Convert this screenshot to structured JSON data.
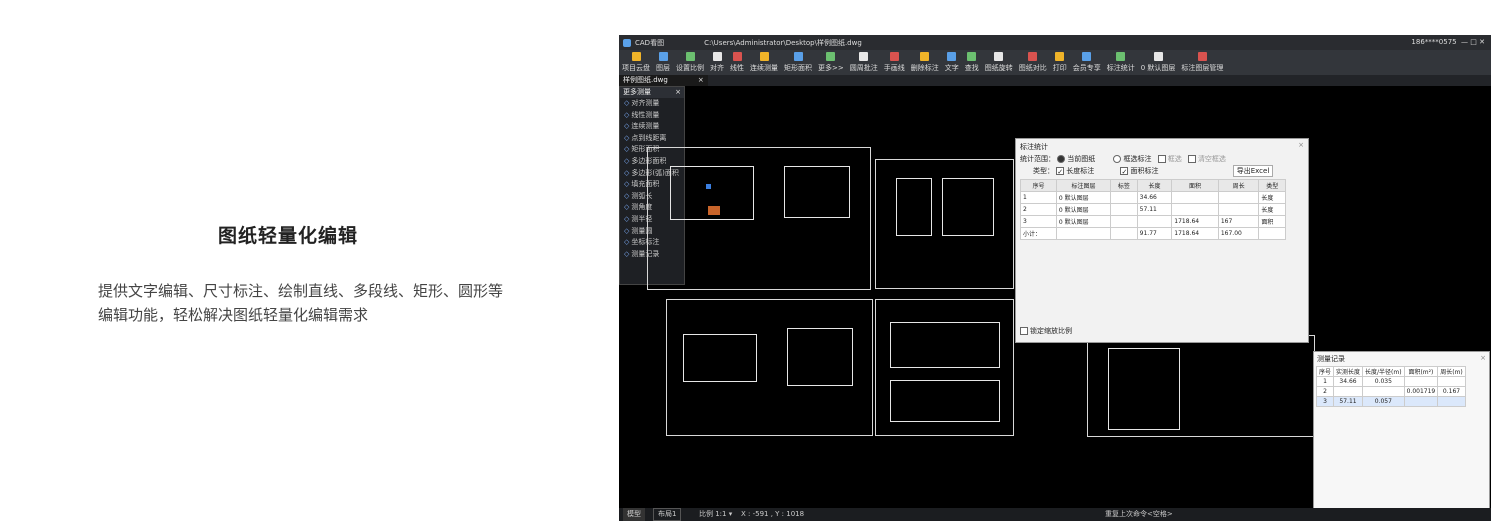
{
  "headline": "图纸轻量化编辑",
  "description": "提供文字编辑、尺寸标注、绘制直线、多段线、矩形、圆形等编辑功能，轻松解决图纸轻量化编辑需求",
  "app": {
    "title": "CAD看图",
    "path": "C:\\Users\\Administrator\\Desktop\\样例图纸.dwg",
    "account": "186****0575",
    "ribbon": [
      "项目云盘",
      "图层",
      "设置比例",
      "对齐",
      "线性",
      "连续测量",
      "矩形面积",
      "更多>>",
      "圆周批注",
      "手画线",
      "删除标注",
      "文字",
      "查找",
      "图纸旋转",
      "图纸对比",
      "打印",
      "会员专享",
      "标注统计",
      "0 默认图层",
      "标注图层管理"
    ],
    "doc_tab": "样例图纸.dwg",
    "colors": {
      "accent": "#4a90e2",
      "bg": "#000000",
      "panel": "#1e2024"
    },
    "panel": {
      "title": "更多测量",
      "items": [
        "对齐测量",
        "线性测量",
        "连续测量",
        "点到线距离",
        "矩形面积",
        "多边形面积",
        "多边形(弧)面积",
        "填充面积",
        "测弧长",
        "测角度",
        "测半径",
        "测量圆",
        "坐标标注",
        "测量记录"
      ]
    },
    "stats": {
      "title": "标注统计",
      "range_label": "统计范围：",
      "opt_current": "当前图纸",
      "opt_box": "框选标注",
      "opt_box2": "框选",
      "opt_clear": "清空框选",
      "type_label": "类型：",
      "type_len": "长度标注",
      "type_area": "面积标注",
      "export": "导出Excel",
      "headers": [
        "序号",
        "标注图层",
        "标签",
        "长度",
        "面积",
        "周长",
        "类型"
      ],
      "rows": [
        [
          "1",
          "0 默认图层",
          "",
          "34.66",
          "",
          "",
          "长度"
        ],
        [
          "2",
          "0 默认图层",
          "",
          "57.11",
          "",
          "",
          "长度"
        ],
        [
          "3",
          "0 默认图层",
          "",
          "",
          "1718.64",
          "167",
          "面积"
        ]
      ],
      "subtotal": [
        "小计：",
        "",
        "",
        "91.77",
        "1718.64",
        "167.00",
        ""
      ],
      "lock": "锁定缩放比例"
    },
    "measure": {
      "title": "测量记录",
      "headers": [
        "序号",
        "实测长度",
        "长度/半径(m)",
        "面积(m²)",
        "周长(m)"
      ],
      "rows": [
        [
          "1",
          "34.66",
          "0.035",
          "",
          ""
        ],
        [
          "2",
          "",
          "",
          "0.001719",
          "0.167"
        ],
        [
          "3",
          "57.11",
          "0.057",
          "",
          ""
        ]
      ]
    },
    "status": {
      "tab_model": "模型",
      "tab_layout": "布局1",
      "scale": "比例 1:1 ▾",
      "coords": "X : -591 , Y : 1018",
      "hint": "重复上次命令<空格>"
    }
  }
}
